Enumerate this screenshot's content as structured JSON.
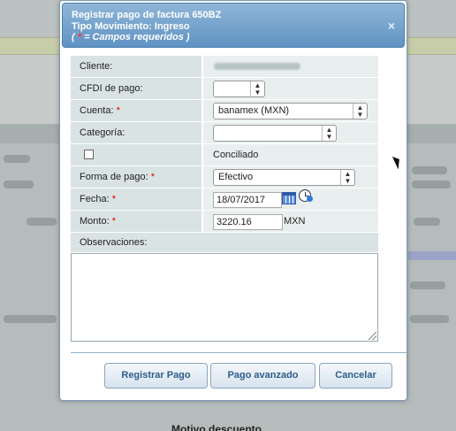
{
  "dialog": {
    "title_line1": "Registrar pago de factura 650BZ",
    "title_line2": "Tipo Movimiento: Ingreso",
    "required_prefix": "( ",
    "required_star": "*",
    "required_suffix": " = Campos requeridos )",
    "close_label": "×"
  },
  "fields": {
    "cliente": {
      "label": "Cliente:",
      "value": "ELECTROSONIDO"
    },
    "cfdi": {
      "label": "CFDI de pago:",
      "value": ""
    },
    "cuenta": {
      "label": "Cuenta: ",
      "star": "*",
      "value": "banamex (MXN)"
    },
    "categoria": {
      "label": "Categoría:",
      "value": ""
    },
    "conciliado": {
      "label": "Conciliado",
      "checked": false
    },
    "forma_pago": {
      "label": "Forma de pago: ",
      "star": "*",
      "value": "Efectivo"
    },
    "fecha": {
      "label": "Fecha: ",
      "star": "*",
      "value": "18/07/2017"
    },
    "monto": {
      "label": "Monto: ",
      "star": "*",
      "value": "3220.16",
      "currency": "MXN"
    },
    "observaciones": {
      "label": "Observaciones:",
      "value": ""
    }
  },
  "buttons": {
    "registrar": "Registrar Pago",
    "avanzado": "Pago avanzado",
    "cancelar": "Cancelar"
  },
  "background": {
    "footer_text": "Motivo descuento"
  },
  "colors": {
    "header_top": "#8fb6d8",
    "header_bottom": "#5f93c3",
    "button_text": "#2f5d8a",
    "required_star": "#dd0000"
  }
}
